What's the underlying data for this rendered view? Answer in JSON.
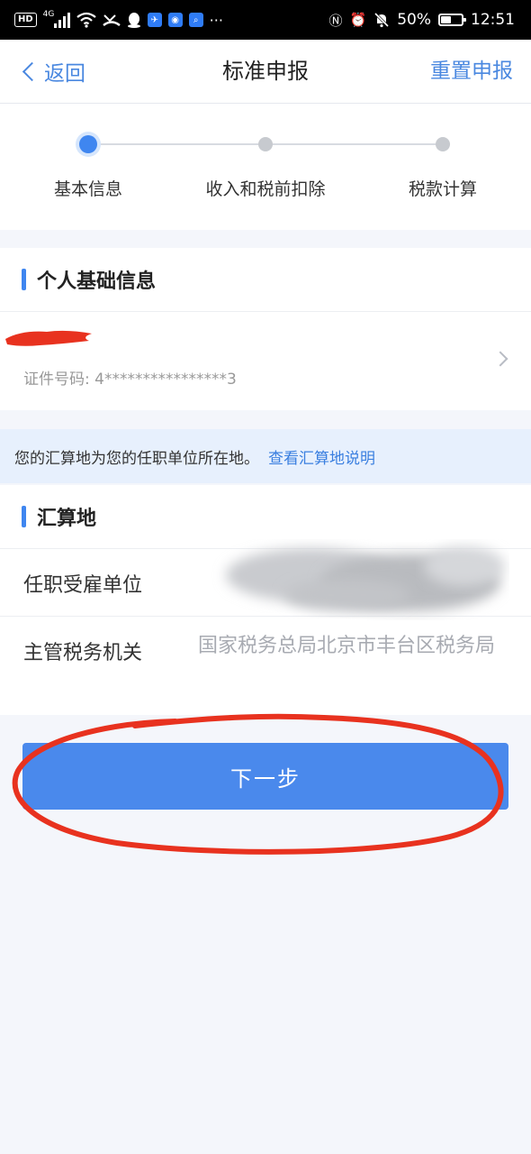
{
  "status_bar": {
    "hd": "HD",
    "network": "4G",
    "battery": "50%",
    "battery_level": 0.5,
    "time": "12:51",
    "more": "···"
  },
  "nav": {
    "back_label": "返回",
    "title": "标准申报",
    "reset_label": "重置申报"
  },
  "stepper": {
    "active_index": 0,
    "steps": [
      {
        "label": "基本信息"
      },
      {
        "label": "收入和税前扣除"
      },
      {
        "label": "税款计算"
      }
    ]
  },
  "personal": {
    "section_title": "个人基础信息",
    "id_label": "证件号码:",
    "id_value": "4****************3"
  },
  "notice": {
    "text": "您的汇算地为您的任职单位所在地。",
    "link": "查看汇算地说明"
  },
  "location": {
    "section_title": "汇算地",
    "employer_label": "任职受雇单位",
    "tax_office_label": "主管税务机关",
    "tax_office_value": "国家税务总局北京市丰台区税务局"
  },
  "next_button": "下一步",
  "colors": {
    "accent": "#3f86f0",
    "button": "#4a89ec",
    "link": "#3a7fe0",
    "annotation_red": "#e8321f",
    "notice_bg": "#e7f0fd",
    "page_bg": "#f4f6fb"
  },
  "icons": {
    "back": "chevron-left-icon",
    "row_arrow": "chevron-right-icon",
    "wifi": "wifi-icon",
    "nfc": "nfc-icon",
    "alarm": "alarm-icon",
    "mute": "bell-off-icon"
  }
}
